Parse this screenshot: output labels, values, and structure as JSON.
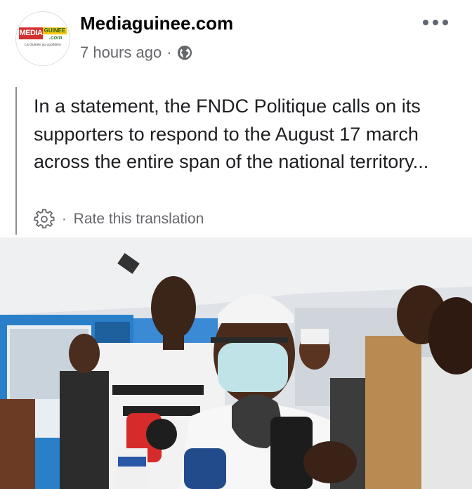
{
  "post": {
    "page_name": "Mediaguinee.com",
    "timestamp": "7 hours ago",
    "separator": "·",
    "audience_icon": "globe-icon",
    "more_icon": "more-dots-icon"
  },
  "avatar": {
    "logo_media": "MEDIA",
    "logo_guinee": "GUINEE",
    "logo_com": ".com",
    "logo_tagline": "La Guinée au quotidien"
  },
  "translation": {
    "text": "In a statement, the FNDC Politique calls on its supporters to respond to the August 17 march across the entire span of the national territory...",
    "settings_icon": "gear-icon",
    "separator": "·",
    "rate_label": "Rate this translation"
  },
  "photo": {
    "icon": "photo-image"
  },
  "colors": {
    "text_primary": "#050505",
    "text_secondary": "#65676b",
    "logo_red": "#d32f2f",
    "logo_yellow": "#f9c80e",
    "logo_green": "#2e7d32"
  }
}
